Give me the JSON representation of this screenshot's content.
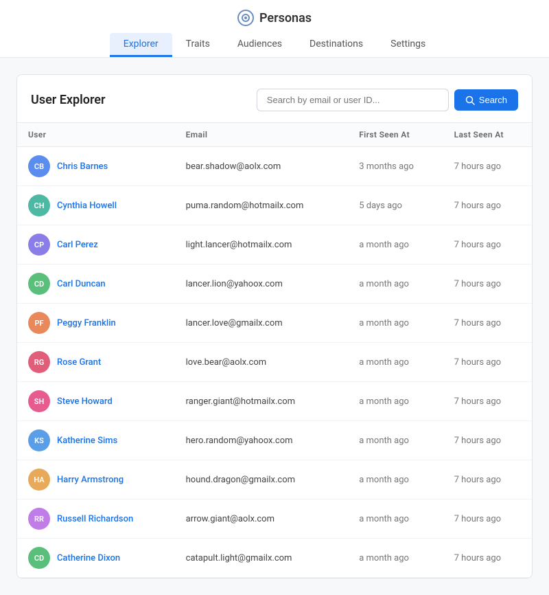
{
  "brand": {
    "name": "Personas",
    "icon_label": "persona-icon"
  },
  "nav": {
    "tabs": [
      {
        "label": "Explorer",
        "active": true
      },
      {
        "label": "Traits",
        "active": false
      },
      {
        "label": "Audiences",
        "active": false
      },
      {
        "label": "Destinations",
        "active": false
      },
      {
        "label": "Settings",
        "active": false
      }
    ]
  },
  "card": {
    "title": "User Explorer",
    "search": {
      "placeholder": "Search by email or user ID...",
      "button_label": "Search"
    }
  },
  "table": {
    "columns": [
      "User",
      "Email",
      "First Seen At",
      "Last Seen At"
    ],
    "rows": [
      {
        "initials": "CB",
        "name": "Chris Barnes",
        "email": "bear.shadow@aolx.com",
        "first_seen": "3 months ago",
        "last_seen": "7 hours ago",
        "color": "#5b8dee"
      },
      {
        "initials": "CH",
        "name": "Cynthia Howell",
        "email": "puma.random@hotmailx.com",
        "first_seen": "5 days ago",
        "last_seen": "7 hours ago",
        "color": "#4db8a4"
      },
      {
        "initials": "CP",
        "name": "Carl Perez",
        "email": "light.lancer@hotmailx.com",
        "first_seen": "a month ago",
        "last_seen": "7 hours ago",
        "color": "#8b7de8"
      },
      {
        "initials": "CD",
        "name": "Carl Duncan",
        "email": "lancer.lion@yahoox.com",
        "first_seen": "a month ago",
        "last_seen": "7 hours ago",
        "color": "#5abf7a"
      },
      {
        "initials": "PF",
        "name": "Peggy Franklin",
        "email": "lancer.love@gmailx.com",
        "first_seen": "a month ago",
        "last_seen": "7 hours ago",
        "color": "#e8885b"
      },
      {
        "initials": "RG",
        "name": "Rose Grant",
        "email": "love.bear@aolx.com",
        "first_seen": "a month ago",
        "last_seen": "7 hours ago",
        "color": "#e05e7a"
      },
      {
        "initials": "SH",
        "name": "Steve Howard",
        "email": "ranger.giant@hotmailx.com",
        "first_seen": "a month ago",
        "last_seen": "7 hours ago",
        "color": "#e85b8e"
      },
      {
        "initials": "KS",
        "name": "Katherine Sims",
        "email": "hero.random@yahoox.com",
        "first_seen": "a month ago",
        "last_seen": "7 hours ago",
        "color": "#5b9ee8"
      },
      {
        "initials": "HA",
        "name": "Harry Armstrong",
        "email": "hound.dragon@gmailx.com",
        "first_seen": "a month ago",
        "last_seen": "7 hours ago",
        "color": "#e8a95b"
      },
      {
        "initials": "RR",
        "name": "Russell Richardson",
        "email": "arrow.giant@aolx.com",
        "first_seen": "a month ago",
        "last_seen": "7 hours ago",
        "color": "#c07de8"
      },
      {
        "initials": "CD",
        "name": "Catherine Dixon",
        "email": "catapult.light@gmailx.com",
        "first_seen": "a month ago",
        "last_seen": "7 hours ago",
        "color": "#5abf7a"
      }
    ]
  }
}
